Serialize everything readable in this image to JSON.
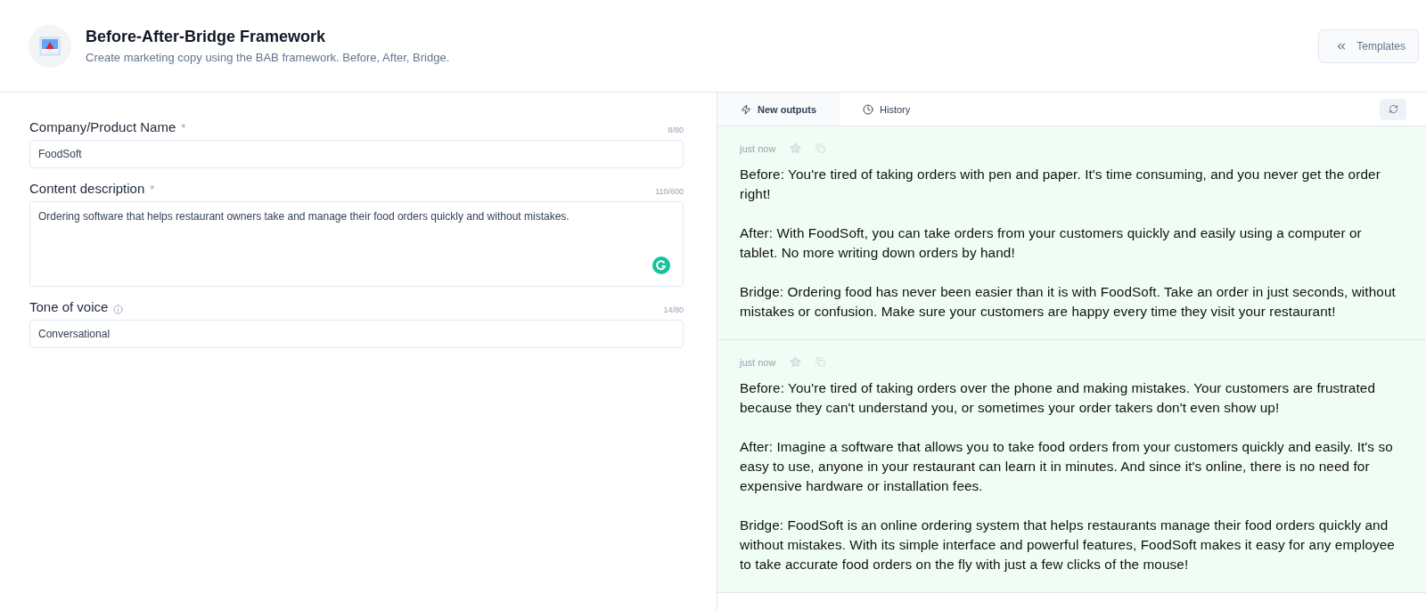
{
  "header": {
    "title": "Before-After-Bridge Framework",
    "subtitle": "Create marketing copy using the BAB framework. Before, After, Bridge.",
    "templates_button": "Templates"
  },
  "form": {
    "fields": [
      {
        "kind": "input",
        "label": "Company/Product Name",
        "required_mark": "*",
        "info": false,
        "counter": "8/80",
        "value": "FoodSoft"
      },
      {
        "kind": "textarea",
        "label": "Content description",
        "required_mark": "*",
        "info": false,
        "counter": "110/600",
        "value": "Ordering software that helps restaurant owners take and manage their food orders quickly and without mistakes."
      },
      {
        "kind": "input",
        "label": "Tone of voice",
        "info": true,
        "counter": "14/80",
        "value": "Conversational"
      }
    ]
  },
  "tabs": [
    {
      "label": "New outputs",
      "selected": true
    },
    {
      "label": "History",
      "selected": false
    }
  ],
  "outputs": [
    {
      "time": "just now",
      "paragraphs": [
        "Before: You're tired of taking orders with pen and paper. It's time consuming, and you never get the order right!",
        "After: With FoodSoft, you can take orders from your customers quickly and easily using a computer or tablet. No more writing down orders by hand!",
        "Bridge: Ordering food has never been easier than it is with FoodSoft. Take an order in just seconds, without mistakes or confusion. Make sure your customers are happy every time they visit your restaurant!"
      ]
    },
    {
      "time": "just now",
      "paragraphs": [
        "Before: You're tired of taking orders over the phone and making mistakes. Your customers are frustrated because they can't understand you, or sometimes your order takers don't even show up!",
        "After: Imagine a software that allows you to take food orders from your customers quickly and easily. It's so easy to use, anyone in your restaurant can learn it in minutes. And since it's online, there is no need for expensive hardware or installation fees.",
        "Bridge: FoodSoft is an online ordering system that helps restaurants manage their food orders quickly and without mistakes. With its simple interface and powerful features, FoodSoft makes it easy for any employee to take accurate food orders on the fly with just a few clicks of the mouse!"
      ]
    }
  ]
}
